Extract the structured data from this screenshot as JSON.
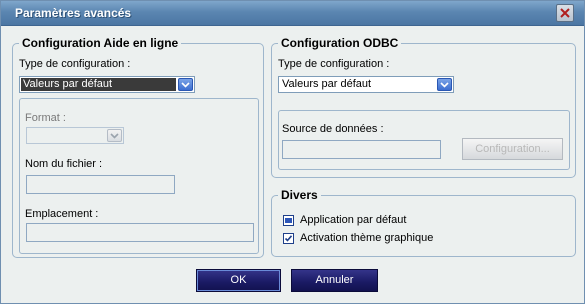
{
  "window": {
    "title": "Paramètres avancés"
  },
  "help_config": {
    "legend": "Configuration Aide en ligne",
    "type_label": "Type de configuration :",
    "type_value": "Valeurs par défaut",
    "format_label": "Format :",
    "format_value": "",
    "filename_label": "Nom du fichier :",
    "filename_value": "",
    "location_label": "Emplacement :",
    "location_value": ""
  },
  "odbc_config": {
    "legend": "Configuration ODBC",
    "type_label": "Type de configuration :",
    "type_value": "Valeurs par défaut",
    "source_label": "Source de données :",
    "source_value": "",
    "config_button": "Configuration..."
  },
  "misc": {
    "legend": "Divers",
    "app_default": {
      "label": "Application par défaut",
      "checked": true
    },
    "theme_activation": {
      "label": "Activation thème graphique",
      "checked": true
    }
  },
  "footer": {
    "ok_label": "OK",
    "cancel_label": "Annuler"
  }
}
